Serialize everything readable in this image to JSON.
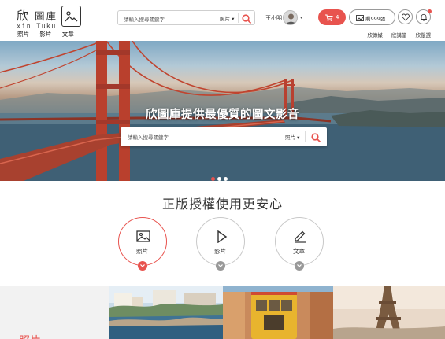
{
  "header": {
    "logo_cn_1": "欣",
    "logo_cn_2": "圖庫",
    "logo_en": "xin Tuku",
    "nav_left": [
      "照片",
      "影片",
      "文章"
    ],
    "search": {
      "placeholder": "請輸入搜尋關鍵字",
      "type_selected": "照片",
      "type_caret": "▾"
    },
    "user": {
      "name": "王小明",
      "caret": "▾"
    },
    "cart": {
      "count": "4"
    },
    "quota": {
      "label": "剩999張"
    },
    "nav_right": [
      "欣傳媒",
      "欣講堂",
      "欣嚴選"
    ]
  },
  "hero": {
    "title": "欣圖庫提供最優質的圖文影音",
    "search": {
      "placeholder": "請輸入搜尋關鍵字",
      "type_selected": "照片",
      "type_caret": "▾"
    },
    "slides": 3,
    "active_slide": 0
  },
  "section": {
    "title": "正版授權使用更安心",
    "categories": [
      {
        "label": "照片",
        "active": true
      },
      {
        "label": "影片",
        "active": false
      },
      {
        "label": "文章",
        "active": false
      }
    ]
  },
  "bottom": {
    "label": "照片"
  },
  "colors": {
    "accent": "#e8534e",
    "border": "#c8c8c8",
    "text": "#333333"
  },
  "icons": {
    "logo": "image-icon",
    "search": "search-icon",
    "cart": "cart-icon",
    "quota": "image-quota-icon",
    "favorite": "heart-icon",
    "notification": "bell-icon",
    "photo": "image-icon",
    "video": "play-icon",
    "article": "pen-icon",
    "expand": "chevron-down-icon"
  }
}
